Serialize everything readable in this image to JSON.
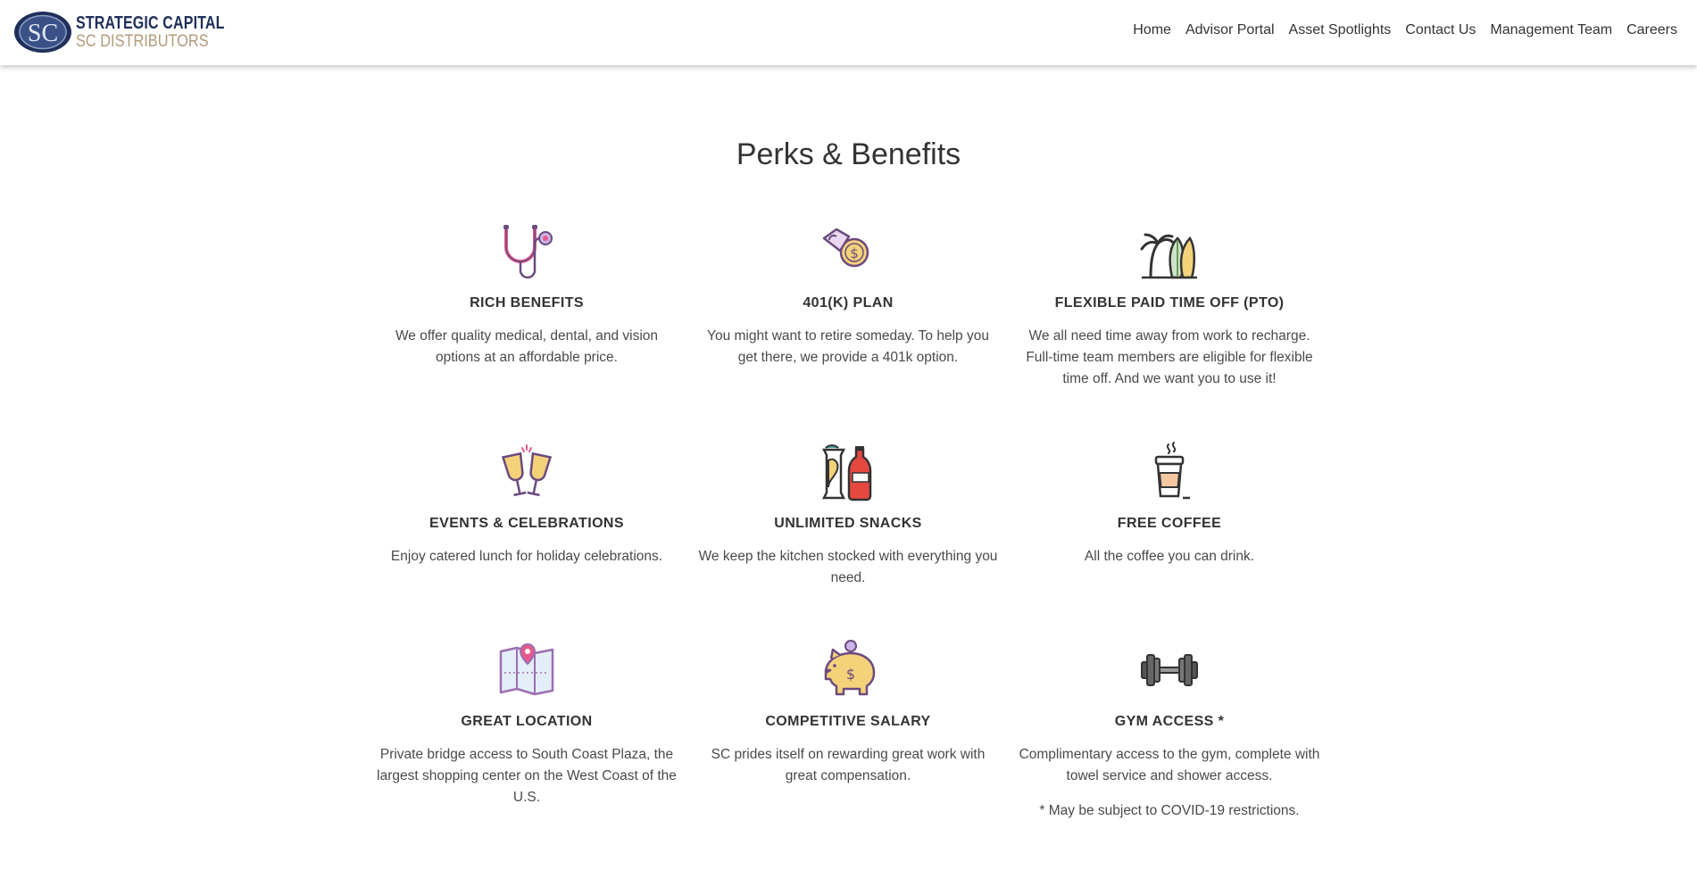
{
  "header": {
    "logo": {
      "monogram": "SC",
      "line1": "STRATEGIC CAPITAL",
      "line2": "SC DISTRIBUTORS"
    },
    "nav": [
      {
        "label": "Home"
      },
      {
        "label": "Advisor Portal"
      },
      {
        "label": "Asset Spotlights"
      },
      {
        "label": "Contact Us"
      },
      {
        "label": "Management Team"
      },
      {
        "label": "Careers"
      }
    ]
  },
  "colors": {
    "brand_navy": "#1f2f5a",
    "brand_tan": "#b49a7a",
    "icon_purple": "#9b6fb0",
    "icon_pink": "#e55a8d",
    "icon_yellow": "#f4d27a"
  },
  "main": {
    "title": "Perks & Benefits",
    "perks": [
      {
        "icon": "stethoscope-icon",
        "title": "RICH BENEFITS",
        "text": "We offer quality medical, dental, and vision options at an affordable price."
      },
      {
        "icon": "coin-hand-icon",
        "title": "401(K) PLAN",
        "text": "You might want to retire someday. To help you get there, we provide a 401k option."
      },
      {
        "icon": "palm-surfboard-icon",
        "title": "FLEXIBLE PAID TIME OFF (PTO)",
        "text": "We all need time away from work to recharge. Full-time team members are eligible for flexible time off. And we want you to use it!"
      },
      {
        "icon": "champagne-toast-icon",
        "title": "EVENTS & CELEBRATIONS",
        "text": "Enjoy catered lunch for holiday celebrations."
      },
      {
        "icon": "snacks-soda-icon",
        "title": "UNLIMITED SNACKS",
        "text": "We keep the kitchen stocked with everything you need."
      },
      {
        "icon": "coffee-cup-icon",
        "title": "FREE COFFEE",
        "text": "All the coffee you can drink."
      },
      {
        "icon": "map-pin-icon",
        "title": "GREAT LOCATION",
        "text": "Private bridge access to South Coast Plaza, the largest shopping center on the West Coast of the U.S."
      },
      {
        "icon": "piggy-bank-icon",
        "title": "COMPETITIVE SALARY",
        "text": "SC prides itself on rewarding great work with great compensation."
      },
      {
        "icon": "dumbbell-icon",
        "title": "GYM ACCESS *",
        "text": "Complimentary access to the gym, complete with towel service and shower access.",
        "note": "* May be subject to COVID-19 restrictions."
      }
    ]
  }
}
